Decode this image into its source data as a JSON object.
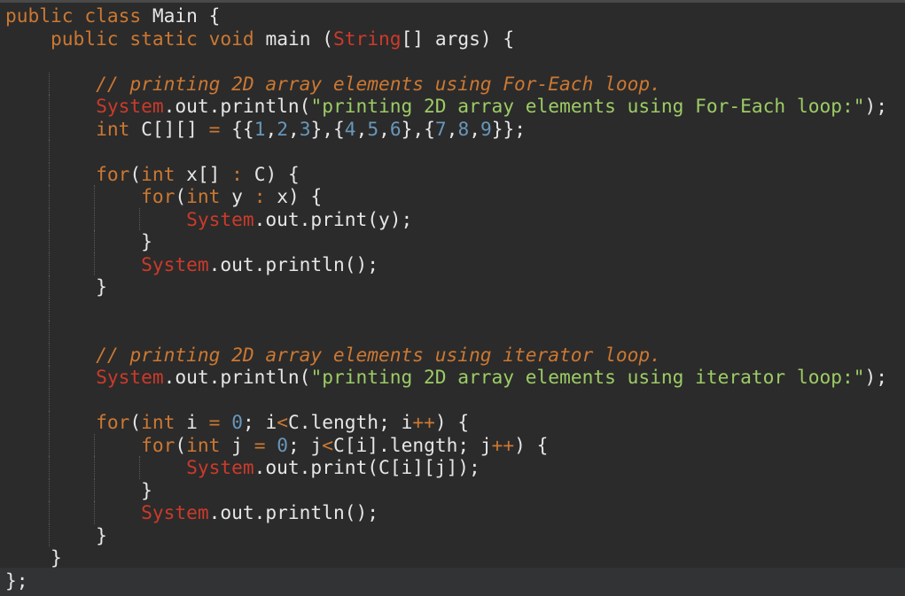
{
  "editor": {
    "language": "Java",
    "theme_colors": {
      "background": "#2b2b2b",
      "keyword": "#cc7832",
      "system_class": "#cc3a2a",
      "string": "#9ccc65",
      "number": "#6897bb",
      "comment": "#cc7832",
      "text": "#e6e6e6"
    }
  },
  "code_lines": [
    {
      "indent": 0,
      "tokens": [
        [
          "kw",
          "public"
        ],
        [
          "pun",
          " "
        ],
        [
          "kw",
          "class"
        ],
        [
          "pun",
          " "
        ],
        [
          "id",
          "Main"
        ],
        [
          "pun",
          " {"
        ]
      ]
    },
    {
      "indent": 1,
      "tokens": [
        [
          "kw",
          "public"
        ],
        [
          "pun",
          " "
        ],
        [
          "kw",
          "static"
        ],
        [
          "pun",
          " "
        ],
        [
          "kw",
          "void"
        ],
        [
          "pun",
          " "
        ],
        [
          "id",
          "main"
        ],
        [
          "pun",
          " ("
        ],
        [
          "type",
          "String"
        ],
        [
          "pun",
          "[] "
        ],
        [
          "id",
          "args"
        ],
        [
          "pun",
          ") {"
        ]
      ]
    },
    {
      "indent": 1,
      "tokens": []
    },
    {
      "indent": 2,
      "tokens": [
        [
          "com",
          "// printing 2D array elements using For-Each loop."
        ]
      ]
    },
    {
      "indent": 2,
      "tokens": [
        [
          "sys",
          "System"
        ],
        [
          "pun",
          ".out.println("
        ],
        [
          "str",
          "\"printing 2D array elements using For-Each loop:\""
        ],
        [
          "pun",
          ");"
        ]
      ]
    },
    {
      "indent": 2,
      "tokens": [
        [
          "kw",
          "int"
        ],
        [
          "pun",
          " C[][] "
        ],
        [
          "op",
          "="
        ],
        [
          "pun",
          " {{"
        ],
        [
          "num",
          "1"
        ],
        [
          "pun",
          ","
        ],
        [
          "num",
          "2"
        ],
        [
          "pun",
          ","
        ],
        [
          "num",
          "3"
        ],
        [
          "pun",
          "},{"
        ],
        [
          "num",
          "4"
        ],
        [
          "pun",
          ","
        ],
        [
          "num",
          "5"
        ],
        [
          "pun",
          ","
        ],
        [
          "num",
          "6"
        ],
        [
          "pun",
          "},{"
        ],
        [
          "num",
          "7"
        ],
        [
          "pun",
          ","
        ],
        [
          "num",
          "8"
        ],
        [
          "pun",
          ","
        ],
        [
          "num",
          "9"
        ],
        [
          "pun",
          "}};"
        ]
      ]
    },
    {
      "indent": 2,
      "tokens": []
    },
    {
      "indent": 2,
      "tokens": [
        [
          "kw",
          "for"
        ],
        [
          "pun",
          "("
        ],
        [
          "kw",
          "int"
        ],
        [
          "pun",
          " x[] "
        ],
        [
          "op",
          ":"
        ],
        [
          "pun",
          " C) {"
        ]
      ]
    },
    {
      "indent": 3,
      "tokens": [
        [
          "kw",
          "for"
        ],
        [
          "pun",
          "("
        ],
        [
          "kw",
          "int"
        ],
        [
          "pun",
          " y "
        ],
        [
          "op",
          ":"
        ],
        [
          "pun",
          " x) {"
        ]
      ]
    },
    {
      "indent": 4,
      "tokens": [
        [
          "sys",
          "System"
        ],
        [
          "pun",
          ".out.print(y);"
        ]
      ]
    },
    {
      "indent": 3,
      "tokens": [
        [
          "pun",
          "}"
        ]
      ]
    },
    {
      "indent": 3,
      "tokens": [
        [
          "sys",
          "System"
        ],
        [
          "pun",
          ".out.println();"
        ]
      ]
    },
    {
      "indent": 2,
      "tokens": [
        [
          "pun",
          "}"
        ]
      ]
    },
    {
      "indent": 2,
      "tokens": []
    },
    {
      "indent": 2,
      "tokens": []
    },
    {
      "indent": 2,
      "tokens": [
        [
          "com",
          "// printing 2D array elements using iterator loop."
        ]
      ]
    },
    {
      "indent": 2,
      "tokens": [
        [
          "sys",
          "System"
        ],
        [
          "pun",
          ".out.println("
        ],
        [
          "str",
          "\"printing 2D array elements using iterator loop:\""
        ],
        [
          "pun",
          ");"
        ]
      ]
    },
    {
      "indent": 2,
      "tokens": []
    },
    {
      "indent": 2,
      "tokens": [
        [
          "kw",
          "for"
        ],
        [
          "pun",
          "("
        ],
        [
          "kw",
          "int"
        ],
        [
          "pun",
          " i "
        ],
        [
          "op",
          "="
        ],
        [
          "pun",
          " "
        ],
        [
          "num",
          "0"
        ],
        [
          "pun",
          "; i"
        ],
        [
          "op",
          "<"
        ],
        [
          "pun",
          "C.length; i"
        ],
        [
          "op",
          "++"
        ],
        [
          "pun",
          ") {"
        ]
      ]
    },
    {
      "indent": 3,
      "tokens": [
        [
          "kw",
          "for"
        ],
        [
          "pun",
          "("
        ],
        [
          "kw",
          "int"
        ],
        [
          "pun",
          " j "
        ],
        [
          "op",
          "="
        ],
        [
          "pun",
          " "
        ],
        [
          "num",
          "0"
        ],
        [
          "pun",
          "; j"
        ],
        [
          "op",
          "<"
        ],
        [
          "pun",
          "C[i].length; j"
        ],
        [
          "op",
          "++"
        ],
        [
          "pun",
          ") {"
        ]
      ]
    },
    {
      "indent": 4,
      "tokens": [
        [
          "sys",
          "System"
        ],
        [
          "pun",
          ".out.print(C[i][j]);"
        ]
      ]
    },
    {
      "indent": 3,
      "tokens": [
        [
          "pun",
          "}"
        ]
      ]
    },
    {
      "indent": 3,
      "tokens": [
        [
          "sys",
          "System"
        ],
        [
          "pun",
          ".out.println();"
        ]
      ]
    },
    {
      "indent": 2,
      "tokens": [
        [
          "pun",
          "}"
        ]
      ]
    },
    {
      "indent": 1,
      "tokens": [
        [
          "pun",
          "}"
        ]
      ]
    },
    {
      "indent": 0,
      "tokens": [
        [
          "pun",
          "};"
        ]
      ]
    }
  ]
}
